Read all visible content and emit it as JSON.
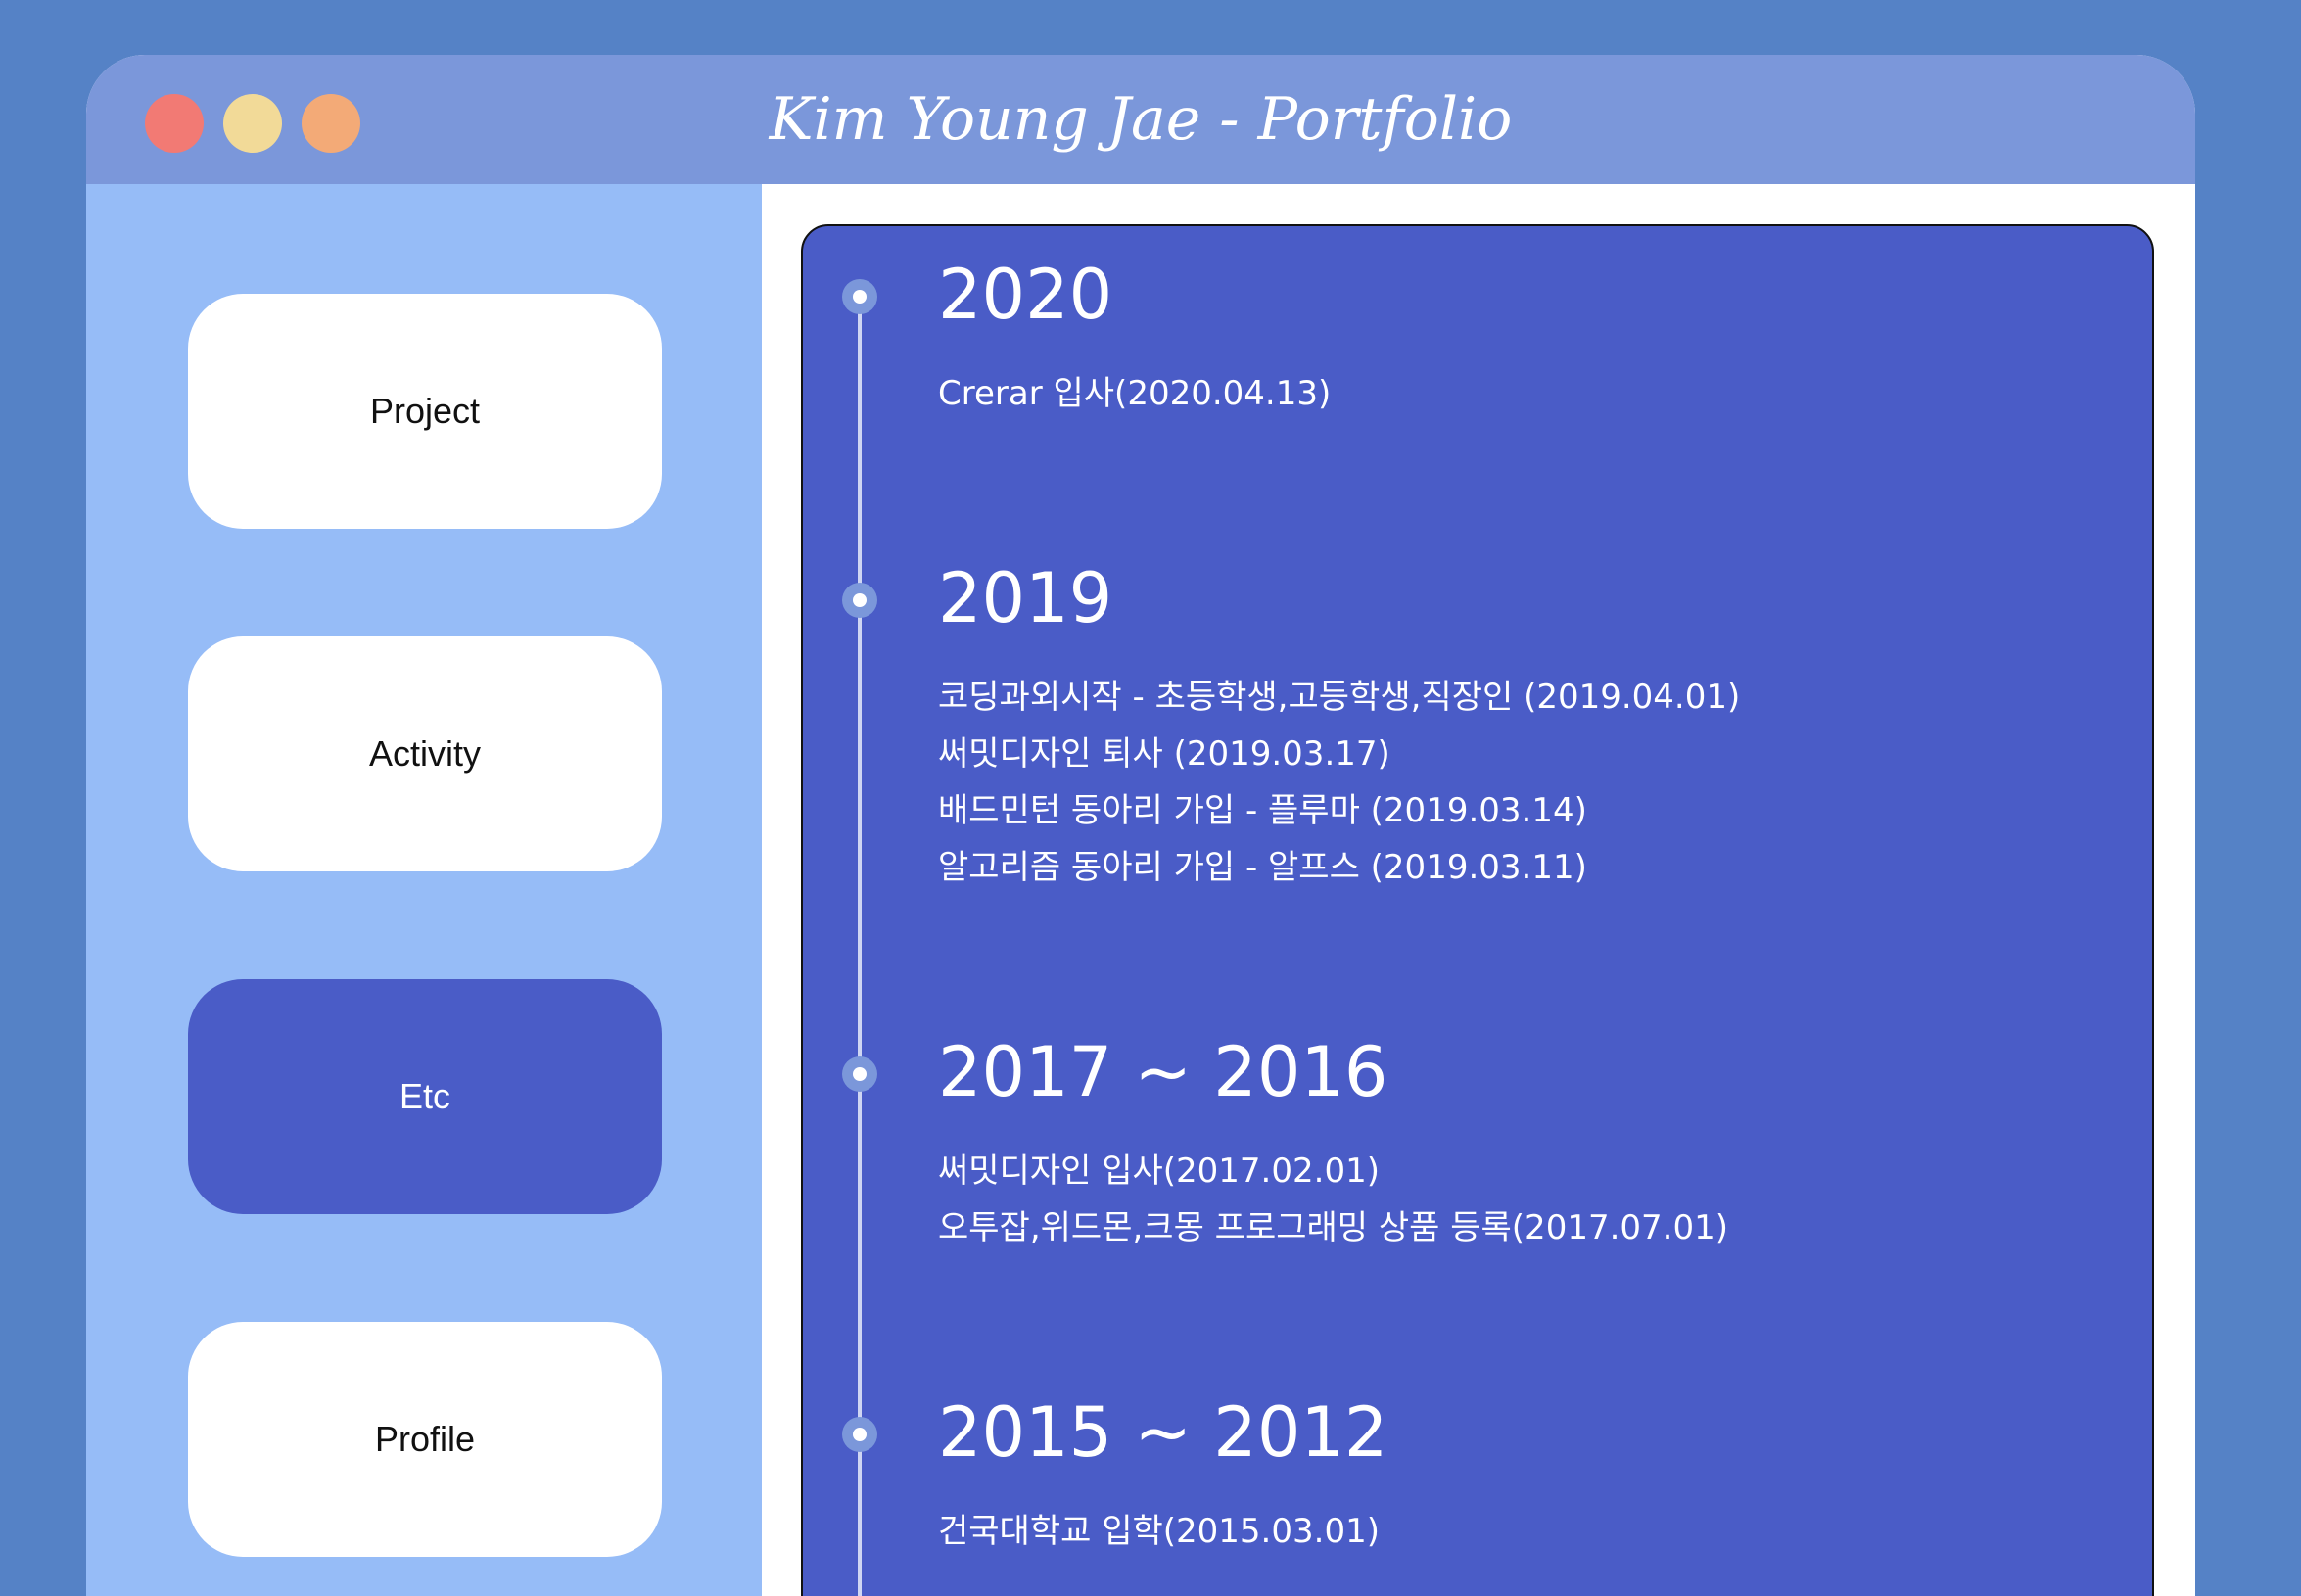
{
  "window": {
    "title": "Kim Young Jae - Portfolio"
  },
  "sidebar": {
    "items": [
      {
        "label": "Project",
        "active": false
      },
      {
        "label": "Activity",
        "active": false
      },
      {
        "label": "Etc",
        "active": true
      },
      {
        "label": "Profile",
        "active": false
      }
    ]
  },
  "timeline": [
    {
      "period": "2020",
      "events": [
        "Crerar 입사(2020.04.13)"
      ]
    },
    {
      "period": "2019",
      "events": [
        "코딩과외시작 - 초등학생,고등학생,직장인 (2019.04.01)",
        "써밋디자인 퇴사 (2019.03.17)",
        "배드민턴 동아리 가입 - 플루마 (2019.03.14)",
        "알고리즘 동아리 가입 - 알프스 (2019.03.11)"
      ]
    },
    {
      "period": "2017 ~ 2016",
      "events": [
        "써밋디자인 입사(2017.02.01)",
        "오투잡,위드몬,크몽 프로그래밍 상품 등록(2017.07.01)"
      ]
    },
    {
      "period": "2015 ~ 2012",
      "events": [
        "건국대학교 입학(2015.03.01)"
      ]
    }
  ],
  "colors": {
    "background": "#5582c6",
    "titlebar": "#7b97da",
    "sidebar": "#96bcf7",
    "accent": "#4a5cc7",
    "dot_red": "#f27a74",
    "dot_yellow": "#f2da98",
    "dot_orange": "#f3aa77"
  }
}
